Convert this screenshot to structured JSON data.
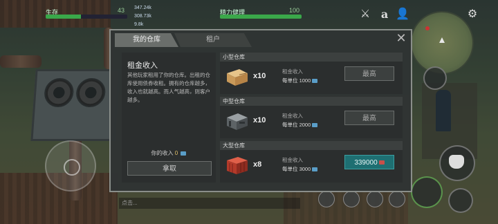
{
  "hud": {
    "health_label": "生存",
    "health_value": "43",
    "health_fill": 0.43,
    "resources": [
      "347.24k",
      "308.73k",
      "9.8k"
    ],
    "energy_label": "精力健理",
    "energy_value": "100",
    "energy_fill": 1.0,
    "chat_placeholder": "点击..."
  },
  "colors": {
    "health": "#3aa84a",
    "energy": "#3aa84a",
    "buy_button": "#1e6f72"
  },
  "dialog": {
    "tabs": [
      {
        "label": "我的仓库",
        "active": true
      },
      {
        "label": "租户",
        "active": false
      }
    ],
    "left": {
      "title": "租金收入",
      "description": "其他玩家租用了你的仓库。出租的仓库使用债券收租。拥有的仓库越多，收入也就越高。而人气越高，则客户越多。",
      "income_label": "你的收入",
      "income_value": "0",
      "collect_label": "拿取"
    },
    "warehouses": [
      {
        "name": "小型仓库",
        "count": "x10",
        "rent_label": "租金收入",
        "rate": "每单位 1000",
        "button_label": "最高",
        "button_type": "max",
        "icon": "small-crate-icon"
      },
      {
        "name": "中型仓库",
        "count": "x10",
        "rent_label": "租金收入",
        "rate": "每单位 2000",
        "button_label": "最高",
        "button_type": "max",
        "icon": "medium-crate-icon"
      },
      {
        "name": "大型仓库",
        "count": "x8",
        "rent_label": "租金收入",
        "rate": "每单位 3000",
        "button_label": "339000",
        "button_type": "buy",
        "icon": "large-container-icon"
      }
    ]
  }
}
